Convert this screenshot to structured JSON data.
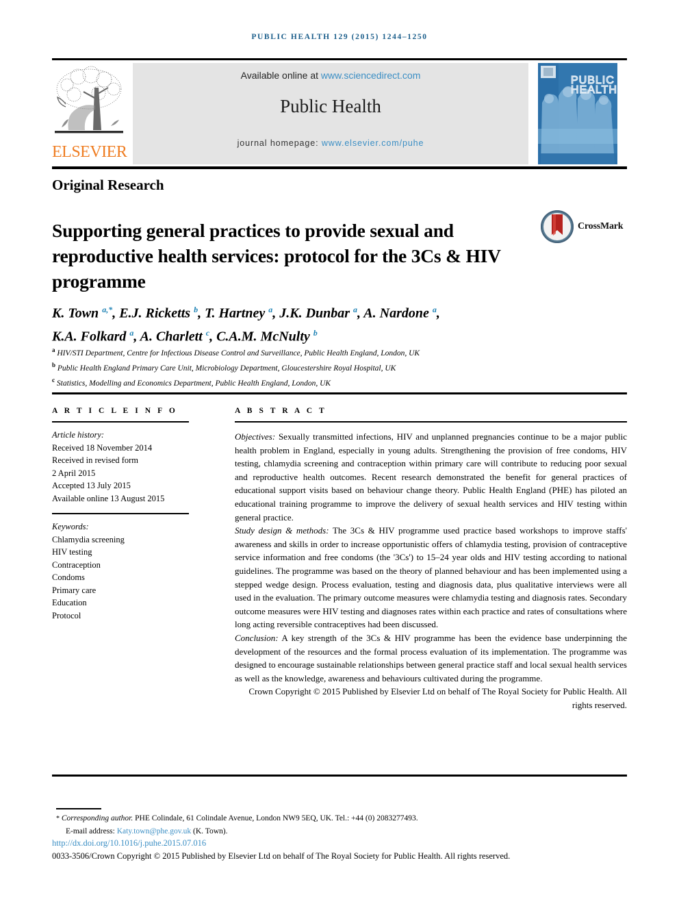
{
  "running_head": "PUBLIC HEALTH 129 (2015) 1244–1250",
  "masthead": {
    "available_prefix": "Available online at ",
    "sciencedirect_url": "www.sciencedirect.com",
    "journal_title": "Public Health",
    "homepage_prefix": "journal homepage: ",
    "homepage_url": "www.elsevier.com/puhe",
    "publisher_name": "ELSEVIER",
    "cover_title_line1": "PUBLIC",
    "cover_title_line2": "HEALTH"
  },
  "article": {
    "type": "Original Research",
    "title": "Supporting general practices to provide sexual and reproductive health services: protocol for the 3Cs & HIV programme",
    "crossmark_label": "CrossMark",
    "authors_line1": "K. Town",
    "authors_html_line1": "K. Town <sup>a,*</sup>, E.J. Ricketts <sup>b</sup>, T. Hartney <sup>a</sup>, J.K. Dunbar <sup>a</sup>, A. Nardone <sup>a</sup>,",
    "authors_html_line2": "K.A. Folkard <sup>a</sup>, A. Charlett <sup>c</sup>, C.A.M. McNulty <sup>b</sup>",
    "affiliations": [
      {
        "marker": "a",
        "text": "HIV/STI Department, Centre for Infectious Disease Control and Surveillance, Public Health England, London, UK"
      },
      {
        "marker": "b",
        "text": "Public Health England Primary Care Unit, Microbiology Department, Gloucestershire Royal Hospital, UK"
      },
      {
        "marker": "c",
        "text": "Statistics, Modelling and Economics Department, Public Health England, London, UK"
      }
    ]
  },
  "article_info": {
    "heading": "A R T I C L E  I N F O",
    "history_label": "Article history:",
    "history": [
      "Received 18 November 2014",
      "Received in revised form",
      "2 April 2015",
      "Accepted 13 July 2015",
      "Available online 13 August 2015"
    ],
    "keywords_label": "Keywords:",
    "keywords": [
      "Chlamydia screening",
      "HIV testing",
      "Contraception",
      "Condoms",
      "Primary care",
      "Education",
      "Protocol"
    ]
  },
  "abstract": {
    "heading": "A B S T R A C T",
    "objectives_label": "Objectives:",
    "objectives_text": " Sexually transmitted infections, HIV and unplanned pregnancies continue to be a major public health problem in England, especially in young adults. Strengthening the provision of free condoms, HIV testing, chlamydia screening and contraception within primary care will contribute to reducing poor sexual and reproductive health outcomes. Recent research demonstrated the benefit for general practices of educational support visits based on behaviour change theory. Public Health England (PHE) has piloted an educational training programme to improve the delivery of sexual health services and HIV testing within general practice.",
    "study_label": "Study design & methods:",
    "study_text": " The 3Cs & HIV programme used practice based workshops to improve staffs' awareness and skills in order to increase opportunistic offers of chlamydia testing, provision of contraceptive service information and free condoms (the '3Cs') to 15–24 year olds and HIV testing according to national guidelines. The programme was based on the theory of planned behaviour and has been implemented using a stepped wedge design. Process evaluation, testing and diagnosis data, plus qualitative interviews were all used in the evaluation. The primary outcome measures were chlamydia testing and diagnosis rates. Secondary outcome measures were HIV testing and diagnoses rates within each practice and rates of consultations where long acting reversible contraceptives had been discussed.",
    "conclusion_label": "Conclusion:",
    "conclusion_text": " A key strength of the 3Cs & HIV programme has been the evidence base underpinning the development of the resources and the formal process evaluation of its implementation. The programme was designed to encourage sustainable relationships between general practice staff and local sexual health services as well as the knowledge, awareness and behaviours cultivated during the programme.",
    "copyright": "Crown Copyright © 2015 Published by Elsevier Ltd on behalf of The Royal Society for Public Health. All rights reserved."
  },
  "footer": {
    "corresponding_star": "*",
    "corresponding_label": "Corresponding author.",
    "corresponding_address": " PHE Colindale, 61 Colindale Avenue, London NW9 5EQ, UK. Tel.: +44 (0) 2083277493.",
    "email_label": "E-mail address: ",
    "email": "Katy.town@phe.gov.uk",
    "email_suffix": " (K. Town).",
    "doi": "http://dx.doi.org/10.1016/j.puhe.2015.07.016",
    "issn_line": "0033-3506/Crown Copyright © 2015 Published by Elsevier Ltd on behalf of The Royal Society for Public Health. All rights reserved."
  },
  "colors": {
    "link_blue": "#3a8ec4",
    "sup_blue": "#2083b5",
    "elsevier_orange": "#ef7d22",
    "cover_blue": "#2b6fa8",
    "runhead_blue": "#1a5d8a"
  }
}
